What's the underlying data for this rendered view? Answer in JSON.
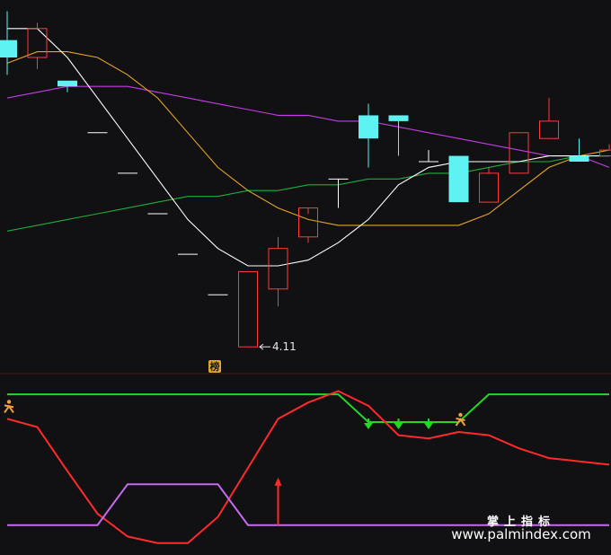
{
  "chart_data": [
    {
      "type": "candlestick",
      "panel": "price",
      "colors": {
        "up": "#ff3b3b",
        "down": "#5ef2f2",
        "flat": "#ffffff",
        "ma_white": "#ffffff",
        "ma_orange": "#e5a623",
        "ma_purple": "#c63ce6",
        "ma_green": "#1fae3e"
      },
      "candles": [
        {
          "o": 4.64,
          "h": 4.69,
          "l": 4.58,
          "c": 4.61
        },
        {
          "o": 4.61,
          "h": 4.67,
          "l": 4.59,
          "c": 4.66
        },
        {
          "o": 4.57,
          "h": 4.57,
          "l": 4.55,
          "c": 4.56
        },
        {
          "o": 4.48,
          "h": 4.48,
          "l": 4.48,
          "c": 4.48
        },
        {
          "o": 4.41,
          "h": 4.41,
          "l": 4.41,
          "c": 4.41
        },
        {
          "o": 4.34,
          "h": 4.34,
          "l": 4.34,
          "c": 4.34
        },
        {
          "o": 4.27,
          "h": 4.27,
          "l": 4.27,
          "c": 4.27
        },
        {
          "o": 4.2,
          "h": 4.2,
          "l": 4.2,
          "c": 4.2
        },
        {
          "o": 4.11,
          "h": 4.24,
          "l": 4.11,
          "c": 4.24
        },
        {
          "o": 4.21,
          "h": 4.3,
          "l": 4.18,
          "c": 4.28
        },
        {
          "o": 4.3,
          "h": 4.34,
          "l": 4.29,
          "c": 4.35
        },
        {
          "o": 4.4,
          "h": 4.4,
          "l": 4.35,
          "c": 4.4
        },
        {
          "o": 4.51,
          "h": 4.53,
          "l": 4.42,
          "c": 4.47
        },
        {
          "o": 4.51,
          "h": 4.51,
          "l": 4.44,
          "c": 4.5
        },
        {
          "o": 4.43,
          "h": 4.45,
          "l": 4.43,
          "c": 4.43
        },
        {
          "o": 4.44,
          "h": 4.44,
          "l": 4.36,
          "c": 4.36
        },
        {
          "o": 4.36,
          "h": 4.42,
          "l": 4.36,
          "c": 4.41
        },
        {
          "o": 4.41,
          "h": 4.48,
          "l": 4.41,
          "c": 4.48
        },
        {
          "o": 4.47,
          "h": 4.54,
          "l": 4.47,
          "c": 4.5
        },
        {
          "o": 4.44,
          "h": 4.47,
          "l": 4.43,
          "c": 4.43
        },
        {
          "o": 4.44,
          "h": 4.46,
          "l": 4.44,
          "c": 4.45
        }
      ],
      "ma_white": [
        4.66,
        4.66,
        4.61,
        4.54,
        4.47,
        4.4,
        4.33,
        4.28,
        4.25,
        4.25,
        4.26,
        4.29,
        4.33,
        4.39,
        4.42,
        4.43,
        4.43,
        4.43,
        4.44,
        4.44,
        4.44
      ],
      "ma_orange": [
        4.6,
        4.62,
        4.62,
        4.61,
        4.58,
        4.54,
        4.48,
        4.42,
        4.38,
        4.35,
        4.33,
        4.32,
        4.32,
        4.32,
        4.32,
        4.32,
        4.34,
        4.38,
        4.42,
        4.44,
        4.45
      ],
      "ma_purple": [
        4.54,
        4.55,
        4.56,
        4.56,
        4.56,
        4.55,
        4.54,
        4.53,
        4.52,
        4.51,
        4.51,
        4.5,
        4.5,
        4.49,
        4.48,
        4.47,
        4.46,
        4.45,
        4.44,
        4.44,
        4.42
      ],
      "ma_green": [
        4.31,
        4.32,
        4.33,
        4.34,
        4.35,
        4.36,
        4.37,
        4.37,
        4.38,
        4.38,
        4.39,
        4.39,
        4.4,
        4.4,
        4.41,
        4.41,
        4.42,
        4.43,
        4.43,
        4.44,
        4.44
      ],
      "ylim": [
        4.07,
        4.7
      ],
      "annotations": {
        "low_value": "4.11",
        "low_index": 8,
        "badge": "榜"
      }
    },
    {
      "type": "line",
      "panel": "indicator",
      "ylim": [
        0,
        100
      ],
      "series": [
        {
          "color": "#22d822",
          "values": [
            95,
            95,
            95,
            95,
            95,
            95,
            95,
            95,
            95,
            95,
            95,
            95,
            78,
            78,
            78,
            78,
            95,
            95,
            95,
            95,
            95
          ]
        },
        {
          "color": "#ff2a2a",
          "values": [
            80,
            75,
            48,
            22,
            8,
            4,
            4,
            20,
            50,
            80,
            90,
            97,
            88,
            70,
            68,
            72,
            70,
            62,
            56,
            54,
            52
          ]
        },
        {
          "color": "#c86af0",
          "values": [
            15,
            15,
            15,
            15,
            40,
            40,
            40,
            40,
            15,
            15,
            15,
            15,
            15,
            15,
            15,
            15,
            15,
            15,
            15,
            15,
            15
          ]
        }
      ],
      "markers": {
        "runner_indexes": [
          0,
          15
        ],
        "down_arrow_indexes": [
          12,
          13,
          14
        ],
        "up_arrow_index": 9
      }
    }
  ],
  "watermark": {
    "cn": "掌上指标",
    "url": "www.palmindex.com"
  }
}
